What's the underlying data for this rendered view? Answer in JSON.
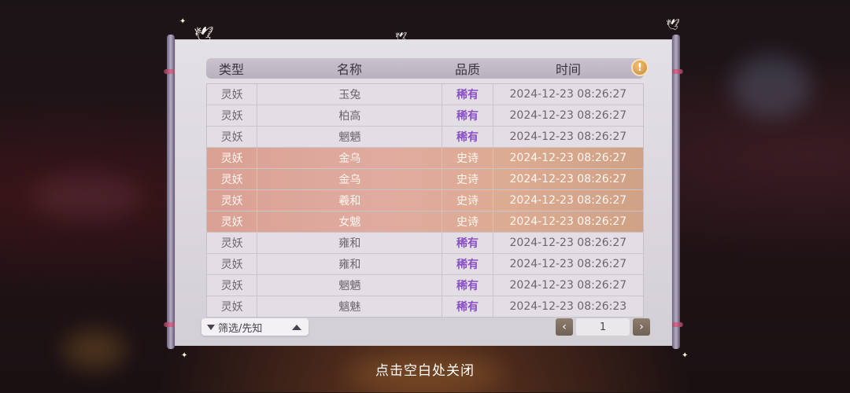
{
  "table": {
    "headers": {
      "type": "类型",
      "name": "名称",
      "quality": "品质",
      "time": "时间"
    },
    "rows": [
      {
        "type": "灵妖",
        "name": "玉兔",
        "quality": "稀有",
        "time": "2024-12-23  08:26:27",
        "tier": "rare"
      },
      {
        "type": "灵妖",
        "name": "柏高",
        "quality": "稀有",
        "time": "2024-12-23  08:26:27",
        "tier": "rare"
      },
      {
        "type": "灵妖",
        "name": "魍魉",
        "quality": "稀有",
        "time": "2024-12-23  08:26:27",
        "tier": "rare"
      },
      {
        "type": "灵妖",
        "name": "金乌",
        "quality": "史诗",
        "time": "2024-12-23  08:26:27",
        "tier": "epic"
      },
      {
        "type": "灵妖",
        "name": "金乌",
        "quality": "史诗",
        "time": "2024-12-23  08:26:27",
        "tier": "epic"
      },
      {
        "type": "灵妖",
        "name": "羲和",
        "quality": "史诗",
        "time": "2024-12-23  08:26:27",
        "tier": "epic"
      },
      {
        "type": "灵妖",
        "name": "女魃",
        "quality": "史诗",
        "time": "2024-12-23  08:26:27",
        "tier": "epic"
      },
      {
        "type": "灵妖",
        "name": "雍和",
        "quality": "稀有",
        "time": "2024-12-23  08:26:27",
        "tier": "rare"
      },
      {
        "type": "灵妖",
        "name": "雍和",
        "quality": "稀有",
        "time": "2024-12-23  08:26:27",
        "tier": "rare"
      },
      {
        "type": "灵妖",
        "name": "魍魉",
        "quality": "稀有",
        "time": "2024-12-23  08:26:27",
        "tier": "rare"
      },
      {
        "type": "灵妖",
        "name": "魑魅",
        "quality": "稀有",
        "time": "2024-12-23  08:26:23",
        "tier": "rare"
      }
    ]
  },
  "info_button": {
    "label": "!"
  },
  "filter": {
    "label": "筛选/先知"
  },
  "pagination": {
    "prev": "‹",
    "page": "1",
    "next": "›"
  },
  "close_hint": "点击空白处关闭",
  "colors": {
    "rare": "#8a4fc6",
    "epic_row": "#dda598",
    "paper": "#dedbe1"
  },
  "icons": {
    "info": "info-icon",
    "filter": "filter-icon",
    "bird": "swallow-icon"
  }
}
